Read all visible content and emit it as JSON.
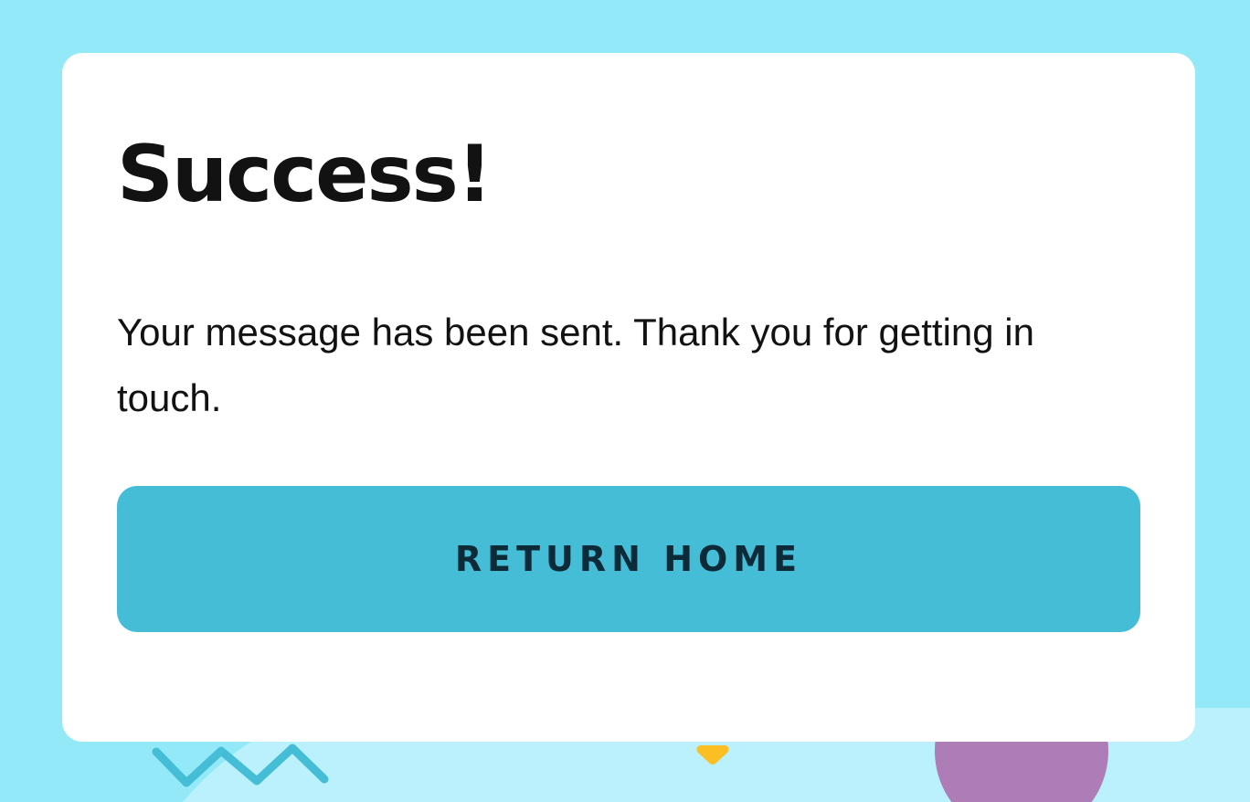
{
  "success": {
    "title": "Success!",
    "message": "Your message has been sent. Thank you for getting in touch.",
    "button_label": "RETURN HOME"
  },
  "colors": {
    "page_background": "#93e9f8",
    "light_wave": "#baf1fc",
    "card_background": "#ffffff",
    "button_background": "#46bdd6",
    "button_text": "#0d2a38",
    "heading_text": "#121212",
    "zigzag": "#46bdd6",
    "triangle": "#fbbf24",
    "circle": "#ae7db7"
  },
  "decorations": {
    "zigzag": "zigzag-line-icon",
    "triangle": "rounded-triangle-icon",
    "circle": "circle-shape"
  }
}
